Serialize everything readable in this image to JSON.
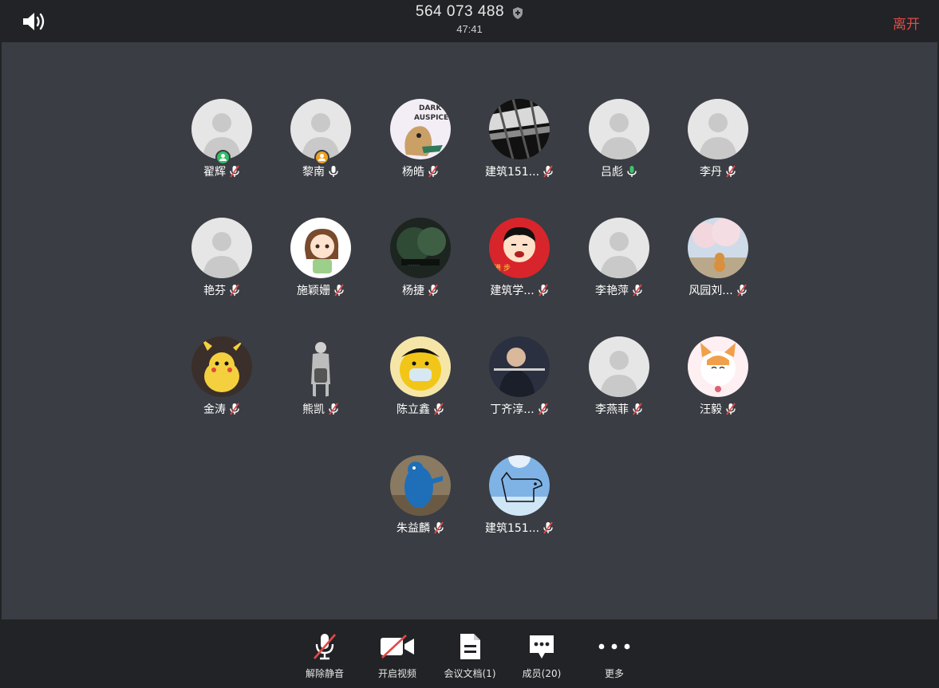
{
  "header": {
    "meeting_id": "564 073 488",
    "timer": "47:41",
    "leave_label": "离开"
  },
  "participants": [
    {
      "name": "翟辉",
      "mic": "muted",
      "avatar": "default",
      "badge": "green"
    },
    {
      "name": "黎南",
      "mic": "on",
      "avatar": "default",
      "badge": "orange"
    },
    {
      "name": "杨皓",
      "mic": "muted",
      "avatar": "cartoon-dark-auspice",
      "badge": ""
    },
    {
      "name": "建筑151...",
      "mic": "muted",
      "avatar": "architecture-photo",
      "badge": ""
    },
    {
      "name": "吕彪",
      "mic": "speaking",
      "avatar": "default",
      "badge": ""
    },
    {
      "name": "李丹",
      "mic": "muted",
      "avatar": "default",
      "badge": ""
    },
    {
      "name": "艳芬",
      "mic": "muted",
      "avatar": "default",
      "badge": ""
    },
    {
      "name": "施颖姗",
      "mic": "muted",
      "avatar": "anime-girl",
      "badge": ""
    },
    {
      "name": "杨捷",
      "mic": "muted",
      "avatar": "forest-photo",
      "badge": ""
    },
    {
      "name": "建筑学...",
      "mic": "muted",
      "avatar": "cartoon-boy-red",
      "badge": ""
    },
    {
      "name": "李艳萍",
      "mic": "muted",
      "avatar": "default",
      "badge": ""
    },
    {
      "name": "风园刘...",
      "mic": "muted",
      "avatar": "cherry-blossom-cat",
      "badge": ""
    },
    {
      "name": "金涛",
      "mic": "muted",
      "avatar": "pikachu",
      "badge": ""
    },
    {
      "name": "熊凯",
      "mic": "muted",
      "avatar": "sketch-figure",
      "badge": ""
    },
    {
      "name": "陈立鑫",
      "mic": "muted",
      "avatar": "yellow-meme",
      "badge": ""
    },
    {
      "name": "丁齐淳...",
      "mic": "muted",
      "avatar": "flute-player",
      "badge": ""
    },
    {
      "name": "李燕菲",
      "mic": "muted",
      "avatar": "default",
      "badge": ""
    },
    {
      "name": "汪毅",
      "mic": "muted",
      "avatar": "orange-cat",
      "badge": ""
    },
    {
      "name": "朱益麟",
      "mic": "muted",
      "avatar": "blue-monster",
      "badge": ""
    },
    {
      "name": "建筑151...",
      "mic": "muted",
      "avatar": "dog-sketch-sky",
      "badge": ""
    }
  ],
  "toolbar": [
    {
      "label": "解除静音",
      "icon": "mic-off-icon"
    },
    {
      "label": "开启视频",
      "icon": "video-off-icon"
    },
    {
      "label": "会议文档(1)",
      "icon": "document-icon"
    },
    {
      "label": "成员(20)",
      "icon": "members-chat-icon"
    },
    {
      "label": "更多",
      "icon": "more-dots-icon"
    }
  ],
  "colors": {
    "leave": "#e04a4a",
    "stage_bg": "#3a3d43",
    "bar_bg": "#222326",
    "mic_muted": "#e04a4a",
    "mic_speaking": "#3ec46d",
    "badge_green": "#2fbf63",
    "badge_orange": "#f0a020"
  }
}
